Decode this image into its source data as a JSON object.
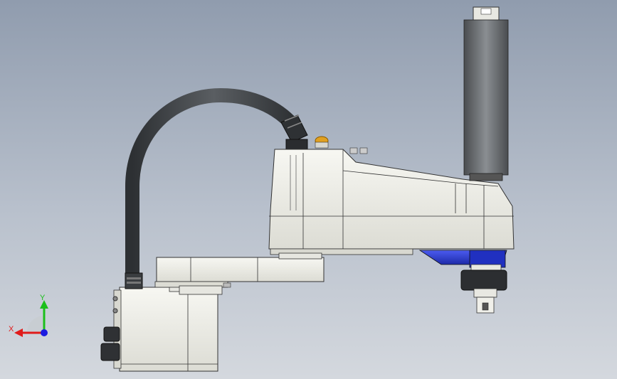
{
  "colors": {
    "background_top": "#909cae",
    "background_bottom": "#d4d8de",
    "body_white": "#f1f1ec",
    "cable_dark": "#3a3d40",
    "bellows": "#55585c",
    "drive_blue": "#2b3ad6",
    "lamp_orange": "#e0a020",
    "axis_x": "#e01b1b",
    "axis_y": "#1bbf1b",
    "axis_z": "#1b1be0"
  },
  "triad": {
    "x_label": "X",
    "y_label": "Y"
  },
  "icons": {
    "triad": "coordinate-triad-icon",
    "lamp": "status-lamp-icon"
  }
}
